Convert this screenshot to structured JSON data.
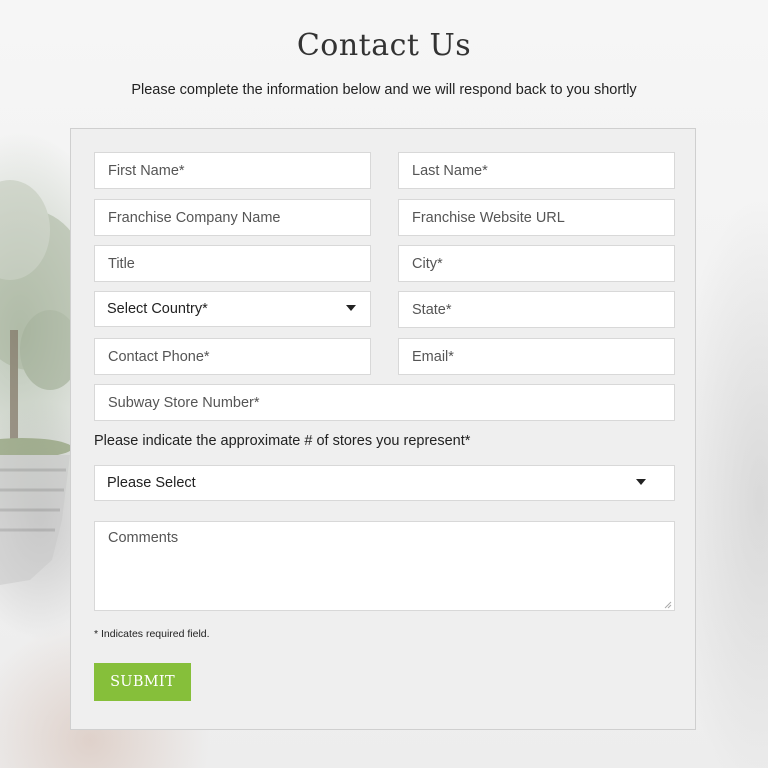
{
  "header": {
    "title": "Contact Us",
    "subtitle": "Please complete the information below and we will respond back to you shortly"
  },
  "form": {
    "first_name": {
      "placeholder": "First Name*"
    },
    "last_name": {
      "placeholder": "Last Name*"
    },
    "franchise_company": {
      "placeholder": "Franchise Company Name"
    },
    "franchise_url": {
      "placeholder": "Franchise Website URL"
    },
    "title_field": {
      "placeholder": "Title"
    },
    "city": {
      "placeholder": "City*"
    },
    "country_select": {
      "value": "Select Country*"
    },
    "state": {
      "placeholder": "State*"
    },
    "contact_phone": {
      "placeholder": "Contact Phone*"
    },
    "email": {
      "placeholder": "Email*"
    },
    "store_number": {
      "placeholder": "Subway Store Number*"
    },
    "stores_question": "Please indicate the approximate # of stores you represent*",
    "stores_select": {
      "value": "Please Select"
    },
    "comments": {
      "placeholder": "Comments"
    },
    "required_note": "* Indicates required field.",
    "submit_label": "SUBMIT"
  },
  "colors": {
    "submit_button": "#86bf3a",
    "panel_background": "#efefef",
    "field_border": "#d8d8d8"
  },
  "icons": [
    "chevron-down-icon",
    "resize-grip-icon"
  ]
}
